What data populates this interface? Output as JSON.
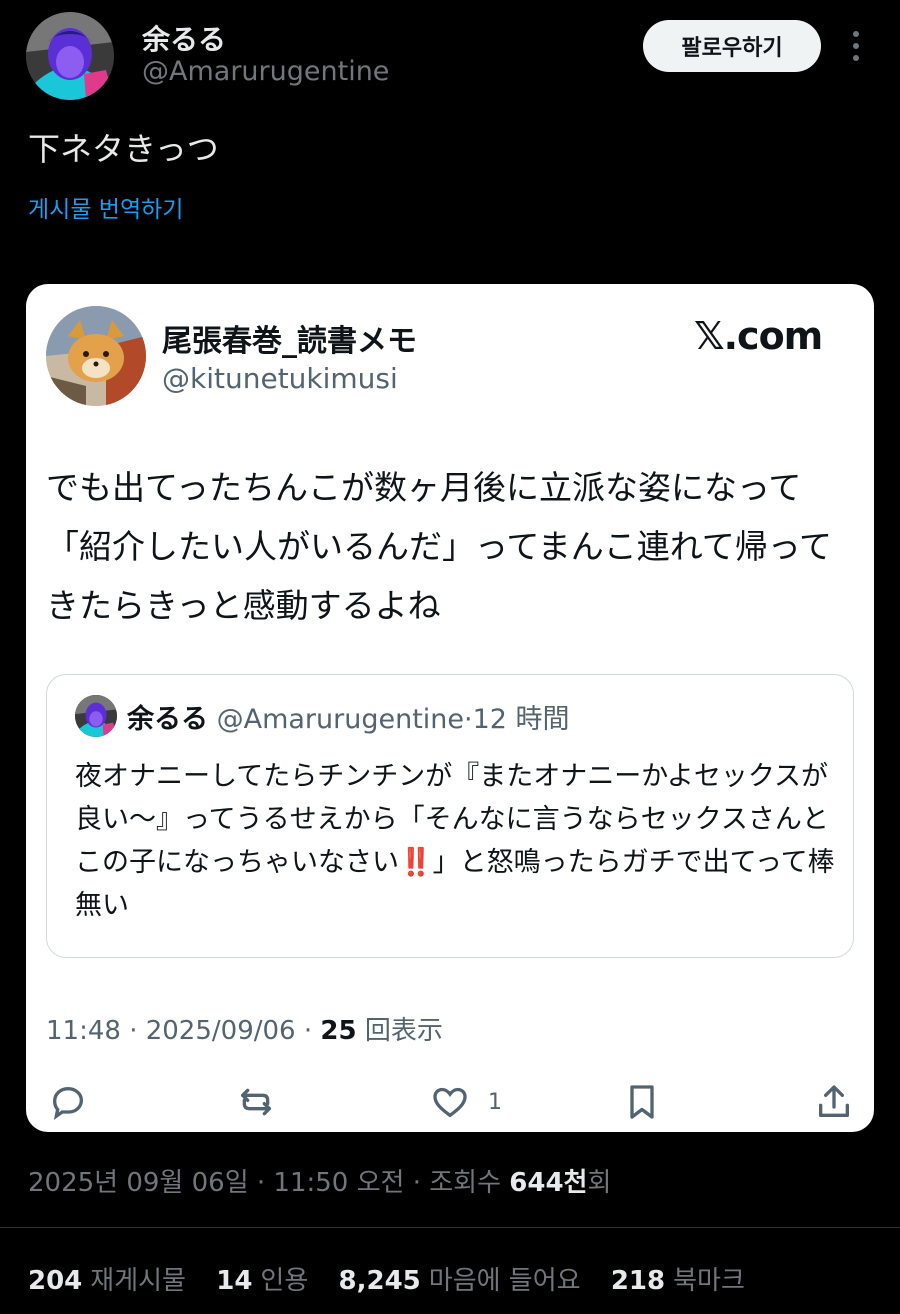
{
  "author": {
    "name": "余るる",
    "handle": "@Amarurugentine",
    "follow_label": "팔로우하기"
  },
  "tweet": {
    "text": "下ネタきっつ",
    "translate_label": "게시물 번역하기"
  },
  "embedded": {
    "author_name": "尾張春巻_読書メモ",
    "author_handle": "@kitunetukimusi",
    "site_logo": "𝕏.com",
    "text": "でも出てったちんこが数ヶ月後に立派な姿になって「紹介したい人がいるんだ」ってまんこ連れて帰ってきたらきっと感動するよね",
    "quote": {
      "name": "余るる",
      "handle": "@Amarurugentine",
      "separator": "·",
      "time": "12 時間",
      "text_before": "夜オナニーしてたらチンチンが『またオナニーかよセックスが良い〜』ってうるせえから「そんなに言うならセックスさんとこの子になっちゃいなさい",
      "emoji": "‼️",
      "text_after": "」と怒鳴ったらガチで出てって棒無い"
    },
    "time_line": "11:48 · 2025/09/06 · ",
    "views_count": "25",
    "views_label": " 回表示",
    "like_count": "1"
  },
  "footer": {
    "time_line": "2025년 09월 06일 · 11:50 오전 · 조회수 ",
    "views_count": "644천",
    "views_label": "회",
    "stats": [
      {
        "count": "204",
        "label": "재게시물"
      },
      {
        "count": "14",
        "label": "인용"
      },
      {
        "count": "8,245",
        "label": "마음에 들어요"
      },
      {
        "count": "218",
        "label": "북마크"
      }
    ]
  },
  "icons": [
    "more-icon",
    "reply-icon",
    "repost-icon",
    "like-icon",
    "bookmark-icon",
    "share-icon"
  ],
  "colors": {
    "background": "#000000",
    "link": "#1d9bf0",
    "muted": "#71767b",
    "card": "#ffffff"
  }
}
